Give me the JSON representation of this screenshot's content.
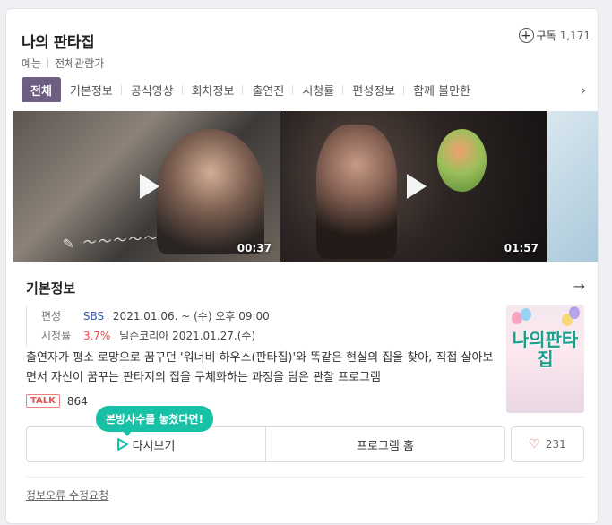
{
  "program": {
    "title": "나의 판타집",
    "genre": "예능",
    "rating": "전체관람가"
  },
  "subscribe": {
    "label": "구독",
    "count": "1,171"
  },
  "tabs": [
    {
      "label": "전체"
    },
    {
      "label": "기본정보"
    },
    {
      "label": "공식영상"
    },
    {
      "label": "회차정보"
    },
    {
      "label": "출연진"
    },
    {
      "label": "시청률"
    },
    {
      "label": "편성정보"
    },
    {
      "label": "함께 볼만한"
    }
  ],
  "clips": [
    {
      "duration": "00:37"
    },
    {
      "duration": "01:57"
    }
  ],
  "basic_info": {
    "section_title": "기본정보",
    "broadcast_label": "편성",
    "channel": "SBS",
    "schedule": "2021.01.06. ~ (수) 오후 09:00",
    "ratings_label": "시청률",
    "ratings_value": "3.7%",
    "ratings_source": "닐슨코리아 2021.01.27.(수)",
    "description": "출연자가 평소 로망으로 꿈꾸던 '워너비 하우스(판타집)'와 똑같은 현실의 집을 찾아, 직접 살아보면서 자신이 꿈꾸는 판타지의 집을 구체화하는 과정을 담은 관찰 프로그램"
  },
  "poster": {
    "title": "나의판타집"
  },
  "talk": {
    "badge": "TALK",
    "count": "864"
  },
  "tooltip": "본방사수를 놓쳤다면!",
  "actions": {
    "vod_label": "다시보기",
    "home_label": "프로그램 홈",
    "like_count": "231"
  },
  "report_link": "정보오류 수정요청",
  "colors": {
    "tab_active": "#6e5e82",
    "tooltip": "#17c1a6",
    "rating": "#e44444",
    "channel": "#3a5aa8"
  }
}
